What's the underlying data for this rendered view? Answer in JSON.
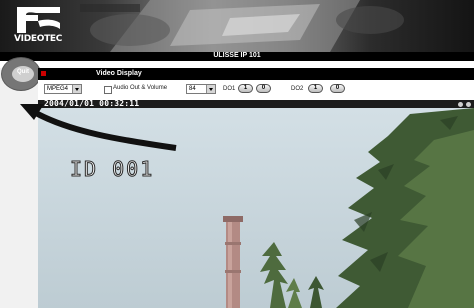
{
  "app": {
    "brand": "VIDEOTEC",
    "title": "ULISSE IP 101"
  },
  "sidebar": {
    "quit_label": "Quit",
    "collapse_marker": ">>"
  },
  "video_panel": {
    "title": "Video Display",
    "codec_value": "MPEG4",
    "audio_label": "Audio Out  & Volume",
    "audio_checked": false,
    "volume_value": "84",
    "do1_label": "DO1",
    "do2_label": "DO2",
    "toggle_on": "1",
    "toggle_off": "0"
  },
  "video": {
    "timestamp": "2004/01/01 00:32:11",
    "camera_id": "ID 001"
  },
  "colors": {
    "accent_red": "#cc0000",
    "header_black": "#000000",
    "sky": "#c9d7de"
  }
}
